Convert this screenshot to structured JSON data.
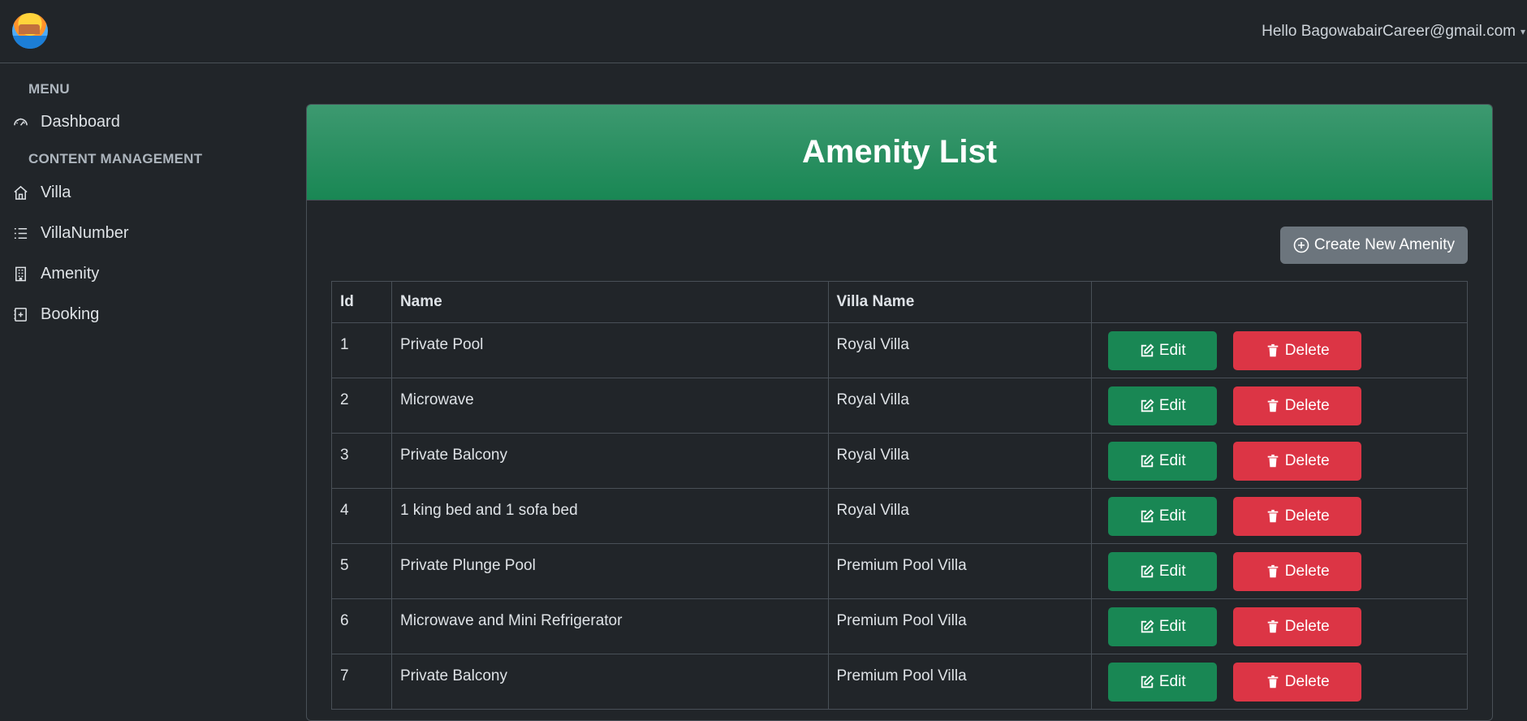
{
  "header": {
    "greeting": "Hello BagowabairCareer@gmail.com"
  },
  "sidebar": {
    "menu_heading": "MENU",
    "dashboard_label": "Dashboard",
    "content_heading": "CONTENT MANAGEMENT",
    "items": [
      {
        "label": "Villa",
        "icon": "house-icon"
      },
      {
        "label": "VillaNumber",
        "icon": "list-icon"
      },
      {
        "label": "Amenity",
        "icon": "building-icon"
      },
      {
        "label": "Booking",
        "icon": "calendar-plus-icon"
      }
    ]
  },
  "page": {
    "title": "Amenity List",
    "create_label": "Create New Amenity"
  },
  "table": {
    "headers": [
      "Id",
      "Name",
      "Villa Name",
      ""
    ],
    "edit_label": "Edit",
    "delete_label": "Delete",
    "rows": [
      {
        "id": "1",
        "name": "Private Pool",
        "villa": "Royal Villa"
      },
      {
        "id": "2",
        "name": "Microwave",
        "villa": "Royal Villa"
      },
      {
        "id": "3",
        "name": "Private Balcony",
        "villa": "Royal Villa"
      },
      {
        "id": "4",
        "name": "1 king bed and 1 sofa bed",
        "villa": "Royal Villa"
      },
      {
        "id": "5",
        "name": "Private Plunge Pool",
        "villa": "Premium Pool Villa"
      },
      {
        "id": "6",
        "name": "Microwave and Mini Refrigerator",
        "villa": "Premium Pool Villa"
      },
      {
        "id": "7",
        "name": "Private Balcony",
        "villa": "Premium Pool Villa"
      }
    ]
  },
  "colors": {
    "background": "#212529",
    "header_green": "#198754",
    "edit_green": "#198754",
    "delete_red": "#dc3545",
    "secondary_gray": "#6c757d"
  }
}
